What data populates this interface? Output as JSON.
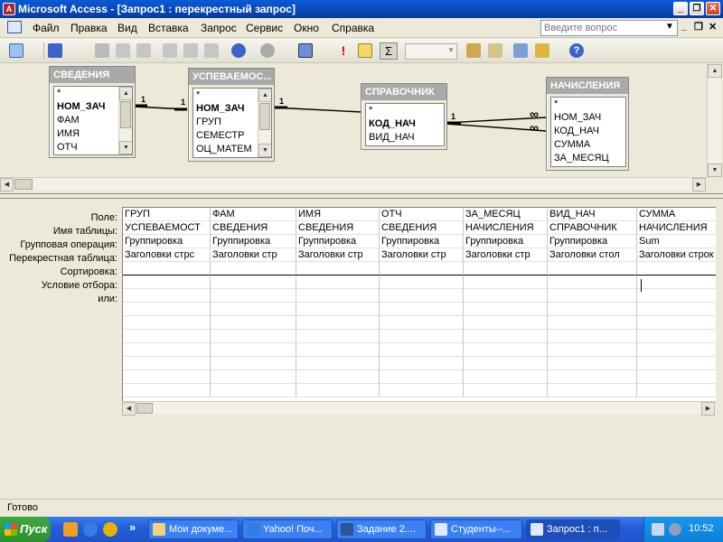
{
  "window": {
    "app_title": "Microsoft Access - [Запрос1 : перекрестный запрос]",
    "btn_minimize": "_",
    "btn_maximize": "❐",
    "btn_close": "✕"
  },
  "menu": {
    "items": [
      "Файл",
      "Правка",
      "Вид",
      "Вставка",
      "Запрос",
      "Сервис",
      "Окно",
      "Справка"
    ],
    "help_placeholder": "Введите вопрос",
    "mdi_minimize": "_",
    "mdi_close": "✕"
  },
  "toolbar": {
    "sigma": "Σ"
  },
  "tables": [
    {
      "caption": "СВЕДЕНИЯ",
      "fields": [
        {
          "name": "*",
          "key": false
        },
        {
          "name": "НОМ_ЗАЧ",
          "key": true
        },
        {
          "name": "ФАМ",
          "key": false
        },
        {
          "name": "ИМЯ",
          "key": false
        },
        {
          "name": "ОТЧ",
          "key": false
        }
      ]
    },
    {
      "caption": "УСПЕВАЕМОС...",
      "fields": [
        {
          "name": "*",
          "key": false
        },
        {
          "name": "НОМ_ЗАЧ",
          "key": true
        },
        {
          "name": "ГРУП",
          "key": false
        },
        {
          "name": "СЕМЕСТР",
          "key": false
        },
        {
          "name": "ОЦ_МАТЕМ",
          "key": false
        }
      ]
    },
    {
      "caption": "СПРАВОЧНИК",
      "fields": [
        {
          "name": "*",
          "key": false
        },
        {
          "name": "КОД_НАЧ",
          "key": true
        },
        {
          "name": "ВИД_НАЧ",
          "key": false
        }
      ]
    },
    {
      "caption": "НАЧИСЛЕНИЯ",
      "fields": [
        {
          "name": "*",
          "key": false
        },
        {
          "name": "НОМ_ЗАЧ",
          "key": false
        },
        {
          "name": "КОД_НАЧ",
          "key": false
        },
        {
          "name": "СУММА",
          "key": false
        },
        {
          "name": "ЗА_МЕСЯЦ",
          "key": false
        }
      ]
    }
  ],
  "relations": {
    "one": "1",
    "many": "∞"
  },
  "qbe": {
    "row_labels": [
      "Поле:",
      "Имя таблицы:",
      "Групповая операция:",
      "Перекрестная таблица:",
      "Сортировка:",
      "Условие отбора:",
      "или:"
    ],
    "columns": [
      [
        "ГРУП",
        "УСПЕВАЕМОСТ",
        "Группировка",
        "Заголовки стрс",
        "",
        ""
      ],
      [
        "ФАМ",
        "СВЕДЕНИЯ",
        "Группировка",
        "Заголовки стр",
        "",
        ""
      ],
      [
        "ИМЯ",
        "СВЕДЕНИЯ",
        "Группировка",
        "Заголовки стр",
        "",
        ""
      ],
      [
        "ОТЧ",
        "СВЕДЕНИЯ",
        "Группировка",
        "Заголовки стр",
        "",
        ""
      ],
      [
        "ЗА_МЕСЯЦ",
        "НАЧИСЛЕНИЯ",
        "Группировка",
        "Заголовки стр",
        "",
        ""
      ],
      [
        "ВИД_НАЧ",
        "СПРАВОЧНИК",
        "Группировка",
        "Заголовки стол",
        "",
        ""
      ],
      [
        "СУММА",
        "НАЧИСЛЕНИЯ",
        "Sum",
        "Заголовки строк",
        "",
        ""
      ]
    ]
  },
  "status": {
    "text": "Готово"
  },
  "taskbar": {
    "start": "Пуск",
    "tasks": [
      "Мои докуме...",
      "Yahoo! Поч...",
      "Задание 2....",
      "Студенты--...",
      "Запрос1 : п..."
    ],
    "clock": "10:52",
    "more": "»"
  }
}
